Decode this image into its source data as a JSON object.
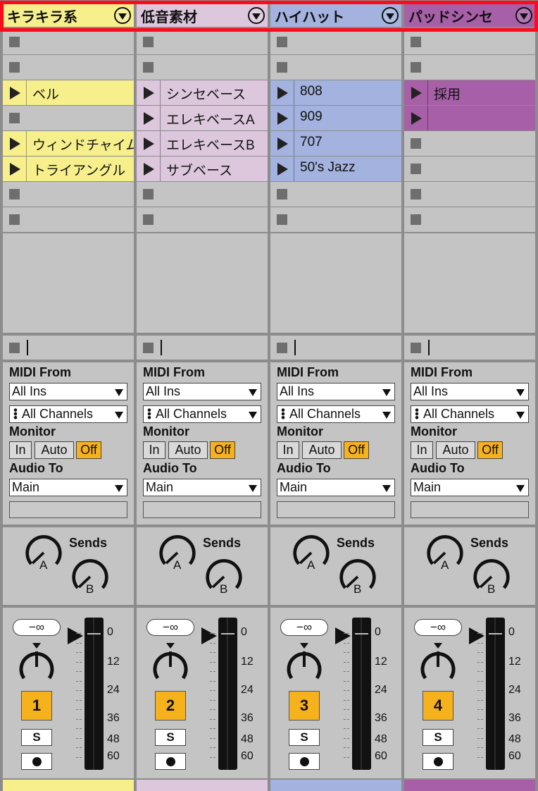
{
  "tracks": [
    {
      "name": "キラキラ系",
      "color": "#f6ef8c",
      "clips": [
        {
          "type": "empty"
        },
        {
          "type": "empty"
        },
        {
          "type": "clip",
          "name": "ベル"
        },
        {
          "type": "empty"
        },
        {
          "type": "clip",
          "name": "ウィンドチャイム"
        },
        {
          "type": "clip",
          "name": "トライアングル"
        },
        {
          "type": "empty"
        },
        {
          "type": "empty"
        }
      ],
      "midi_from": "All Ins",
      "channels": "All Channels",
      "audio_to": "Main",
      "number": "1"
    },
    {
      "name": "低音素材",
      "color": "#dcc7dc",
      "clips": [
        {
          "type": "empty"
        },
        {
          "type": "empty"
        },
        {
          "type": "clip",
          "name": "シンセベース"
        },
        {
          "type": "clip",
          "name": "エレキベースA"
        },
        {
          "type": "clip",
          "name": "エレキベースB"
        },
        {
          "type": "clip",
          "name": "サブベース"
        },
        {
          "type": "empty"
        },
        {
          "type": "empty"
        }
      ],
      "midi_from": "All Ins",
      "channels": "All Channels",
      "audio_to": "Main",
      "number": "2"
    },
    {
      "name": "ハイハット",
      "color": "#a3b2df",
      "clips": [
        {
          "type": "empty"
        },
        {
          "type": "empty"
        },
        {
          "type": "clip",
          "name": "808"
        },
        {
          "type": "clip",
          "name": "909"
        },
        {
          "type": "clip",
          "name": "707"
        },
        {
          "type": "clip",
          "name": "50's Jazz"
        },
        {
          "type": "empty"
        },
        {
          "type": "empty"
        }
      ],
      "midi_from": "All Ins",
      "channels": "All Channels",
      "audio_to": "Main",
      "number": "3"
    },
    {
      "name": "パッドシンセ",
      "color": "#a75fa7",
      "clips": [
        {
          "type": "empty"
        },
        {
          "type": "empty"
        },
        {
          "type": "clip",
          "name": "採用"
        },
        {
          "type": "clip",
          "name": ""
        },
        {
          "type": "empty"
        },
        {
          "type": "empty"
        },
        {
          "type": "empty"
        },
        {
          "type": "empty"
        }
      ],
      "midi_from": "All Ins",
      "channels": "All Channels",
      "audio_to": "Main",
      "number": "4"
    }
  ],
  "labels": {
    "midi_from": "MIDI From",
    "monitor": "Monitor",
    "audio_to": "Audio To",
    "sends": "Sends",
    "send_a": "A",
    "send_b": "B",
    "monitor_in": "In",
    "monitor_auto": "Auto",
    "monitor_off": "Off",
    "volume_readout": "−∞",
    "solo": "S"
  },
  "monitor_selected": "Off",
  "meter_scale": [
    "0",
    "12",
    "24",
    "36",
    "48",
    "60"
  ],
  "colors": {
    "accent_orange": "#f6b21c",
    "selection_outline": "#ff0a1a",
    "panel_bg": "#c4c4c4"
  },
  "icons": {
    "track_fold": "chevron-down-circle-icon",
    "clip_play": "play-triangle-icon",
    "clip_stop": "stop-square-icon",
    "channel_select": "dotted-channel-icon",
    "arm": "record-arm-icon"
  }
}
